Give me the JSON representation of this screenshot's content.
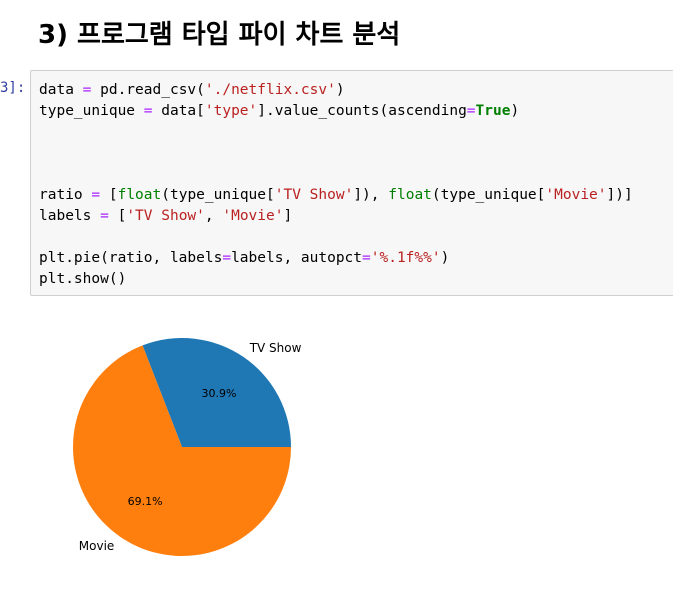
{
  "heading": "3) 프로그램 타입 파이 차트 분석",
  "cell": {
    "prompt": "3]:",
    "lines": [
      [
        {
          "t": "data "
        },
        {
          "t": "=",
          "c": "op"
        },
        {
          "t": " pd.read_csv("
        },
        {
          "t": "'./netflix.csv'",
          "c": "str"
        },
        {
          "t": ")"
        }
      ],
      [
        {
          "t": "type_unique "
        },
        {
          "t": "=",
          "c": "op"
        },
        {
          "t": " data["
        },
        {
          "t": "'type'",
          "c": "str"
        },
        {
          "t": "].value_counts(ascending"
        },
        {
          "t": "=",
          "c": "op"
        },
        {
          "t": "True",
          "c": "true"
        },
        {
          "t": ")"
        }
      ],
      [],
      [],
      [],
      [
        {
          "t": "ratio "
        },
        {
          "t": "=",
          "c": "op"
        },
        {
          "t": " ["
        },
        {
          "t": "float",
          "c": "bi"
        },
        {
          "t": "(type_unique["
        },
        {
          "t": "'TV Show'",
          "c": "str"
        },
        {
          "t": "]), "
        },
        {
          "t": "float",
          "c": "bi"
        },
        {
          "t": "(type_unique["
        },
        {
          "t": "'Movie'",
          "c": "str"
        },
        {
          "t": "])]"
        }
      ],
      [
        {
          "t": "labels "
        },
        {
          "t": "=",
          "c": "op"
        },
        {
          "t": " ["
        },
        {
          "t": "'TV Show'",
          "c": "str"
        },
        {
          "t": ", "
        },
        {
          "t": "'Movie'",
          "c": "str"
        },
        {
          "t": "]"
        }
      ],
      [],
      [
        {
          "t": "plt.pie(ratio, labels"
        },
        {
          "t": "=",
          "c": "op"
        },
        {
          "t": "labels, autopct"
        },
        {
          "t": "=",
          "c": "op"
        },
        {
          "t": "'%.1f%%'",
          "c": "str"
        },
        {
          "t": ")"
        }
      ],
      [
        {
          "t": "plt.show()"
        }
      ]
    ]
  },
  "chart_data": {
    "type": "pie",
    "labels": [
      "TV Show",
      "Movie"
    ],
    "values": [
      30.9,
      69.1
    ],
    "autopct": [
      "30.9%",
      "69.1%"
    ],
    "colors": [
      "#1f77b4",
      "#ff7f0e"
    ],
    "start_angle_deg": 0,
    "direction": "counterclockwise"
  }
}
